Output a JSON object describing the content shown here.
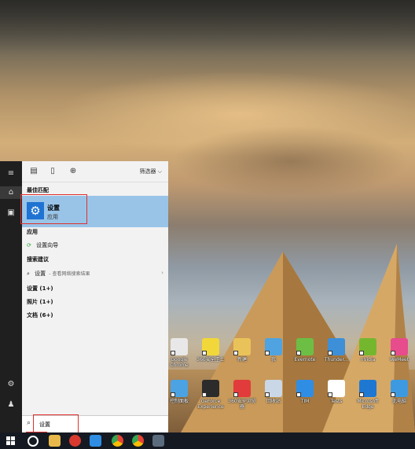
{
  "start_menu": {
    "filters_label": "筛选器",
    "best_match_header": "最佳匹配",
    "best_match": {
      "title": "设置",
      "subtitle": "应用"
    },
    "apps_header": "应用",
    "apps": [
      {
        "label": "设置向导"
      }
    ],
    "suggestions_header": "搜索建议",
    "suggestion": {
      "term": "设置",
      "note": "- 查看网络搜索结果"
    },
    "categories": [
      "设置 (1+)",
      "照片 (1+)",
      "文档 (6+)"
    ],
    "search_query": "设置"
  },
  "desktop_icons_row1": [
    {
      "label": "Google Chrome",
      "color": "#e8e8e8"
    },
    {
      "label": "360安全卫士",
      "color": "#f2d73a"
    },
    {
      "label": "新建",
      "color": "#e9c35a"
    },
    {
      "label": "我",
      "color": "#4fa3e0"
    },
    {
      "label": "Evernote",
      "color": "#6cbf44"
    },
    {
      "label": "Thunder...",
      "color": "#3d8fd8"
    },
    {
      "label": "nVidia",
      "color": "#74b72e"
    },
    {
      "label": "WeMeet",
      "color": "#e74c8c"
    }
  ],
  "desktop_icons_row2": [
    {
      "label": "控制面板",
      "color": "#4ba3e3"
    },
    {
      "label": "GeForce Experience",
      "color": "#2b2b2b"
    },
    {
      "label": "360安全浏览器",
      "color": "#e23b3b"
    },
    {
      "label": "回收站",
      "color": "#c9d7e6"
    },
    {
      "label": "TIM",
      "color": "#2f8de4"
    },
    {
      "label": "Tests",
      "color": "#ffffff"
    },
    {
      "label": "Microsoft Edge",
      "color": "#1e78d2"
    },
    {
      "label": "此电脑",
      "color": "#3e9ae0"
    }
  ],
  "colors": {
    "accent": "#1f73d2",
    "best_match_bg": "#99c4e8",
    "highlight": "#e0302c",
    "taskbar": "#151a22"
  }
}
